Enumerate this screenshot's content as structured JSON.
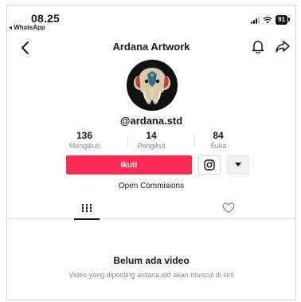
{
  "status_bar": {
    "time": "08.25",
    "back_app": "◂ WhatsApp",
    "battery": "91"
  },
  "nav": {
    "back_icon": "chevron-left-icon",
    "title": "Ardana Artwork",
    "bell_icon": "bell-icon",
    "share_icon": "share-icon"
  },
  "profile": {
    "avatar_icon": "elephant-logo",
    "handle": "@ardana.std",
    "stats": [
      {
        "value": "136",
        "label": "Mengikuti"
      },
      {
        "value": "14",
        "label": "Pengikut"
      },
      {
        "value": "84",
        "label": "Suka"
      }
    ],
    "follow_label": "Ikuti",
    "instagram_icon": "instagram-icon",
    "more_icon": "caret-down-icon",
    "bio": "Open Commisions"
  },
  "tabs": [
    {
      "icon": "grid-icon",
      "active": true
    },
    {
      "icon": "heart-icon",
      "active": false
    }
  ],
  "empty_state": {
    "title": "Belum ada video",
    "subtitle": "Video yang diposting ardana.std akan muncul di sini"
  },
  "colors": {
    "accent": "#fe2c55",
    "text": "#161823",
    "muted": "#8a8b91"
  }
}
